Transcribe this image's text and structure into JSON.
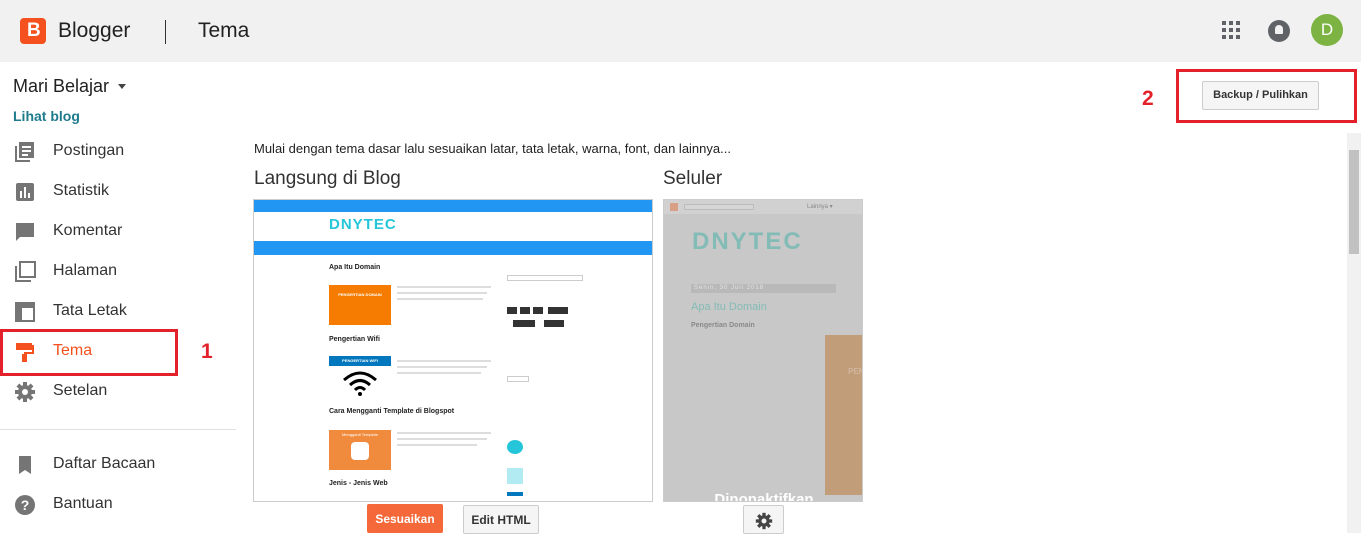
{
  "header": {
    "brand": "Blogger",
    "logo_letter": "B",
    "page_title": "Tema",
    "avatar_letter": "D"
  },
  "sidebar": {
    "blog_name": "Mari Belajar",
    "view_blog": "Lihat blog",
    "items": [
      {
        "label": "Postingan",
        "icon": "posts-icon"
      },
      {
        "label": "Statistik",
        "icon": "stats-icon"
      },
      {
        "label": "Komentar",
        "icon": "comments-icon"
      },
      {
        "label": "Halaman",
        "icon": "pages-icon"
      },
      {
        "label": "Tata Letak",
        "icon": "layout-icon"
      },
      {
        "label": "Tema",
        "icon": "theme-icon"
      },
      {
        "label": "Setelan",
        "icon": "gear-icon"
      }
    ],
    "secondary": [
      {
        "label": "Daftar Bacaan",
        "icon": "bookmark-icon"
      },
      {
        "label": "Bantuan",
        "icon": "help-icon"
      }
    ]
  },
  "annotations": {
    "marker1": "1",
    "marker2": "2"
  },
  "main": {
    "backup_button": "Backup / Pulihkan",
    "intro": "Mulai dengan tema dasar lalu sesuaikan latar, tata letak, warna, font, dan lainnya...",
    "live_title": "Langsung di Blog",
    "mobile_title": "Seluler",
    "customize_button": "Sesuaikan",
    "edit_html_button": "Edit HTML"
  },
  "preview": {
    "logo": "DNYTEC",
    "posts": [
      {
        "title": "Apa Itu Domain",
        "thumb": "PENGERTIAN DOMAIN"
      },
      {
        "title": "Pengertian Wifi",
        "thumb": "PENGERTIAN WIFI"
      },
      {
        "title": "Cara Mengganti Template di Blogspot",
        "thumb": "Mengganti Template"
      },
      {
        "title": "Jenis - Jenis Web"
      }
    ],
    "mobile_date": "Senin, 30 Juli 2018",
    "mobile_post_title": "Apa Itu Domain",
    "mobile_post_sub": "Pengertian Domain",
    "mobile_more": "Lainnya ▾",
    "mobile_disabled": "Dinonaktifkan",
    "mobile_thumb_text": "PEN"
  },
  "colors": {
    "accent": "#f4511e",
    "marker": "#e3212b",
    "link": "#1e7b8c",
    "preview_nav": "#2196f3",
    "preview_logo": "#26c6da"
  }
}
